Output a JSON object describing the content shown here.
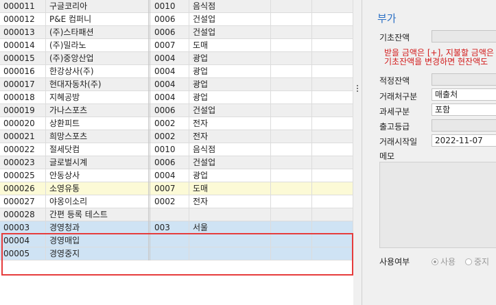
{
  "grid": {
    "rows": [
      {
        "code": "000011",
        "name": "구글코리아",
        "tcode": "0010",
        "tname": "음식점"
      },
      {
        "code": "000012",
        "name": "P&E 컴퍼니",
        "tcode": "0006",
        "tname": "건설업"
      },
      {
        "code": "000013",
        "name": "(주)스타패션",
        "tcode": "0006",
        "tname": "건설업"
      },
      {
        "code": "000014",
        "name": "(주)밀라노",
        "tcode": "0007",
        "tname": "도매"
      },
      {
        "code": "000015",
        "name": "(주)중앙산업",
        "tcode": "0004",
        "tname": "광업"
      },
      {
        "code": "000016",
        "name": "한강상사(주)",
        "tcode": "0004",
        "tname": "광업"
      },
      {
        "code": "000017",
        "name": "현대자동차(주)",
        "tcode": "0004",
        "tname": "광업"
      },
      {
        "code": "000018",
        "name": "지혜공방",
        "tcode": "0004",
        "tname": "광업"
      },
      {
        "code": "000019",
        "name": "가나스포츠",
        "tcode": "0006",
        "tname": "건설업"
      },
      {
        "code": "000020",
        "name": "상환피트",
        "tcode": "0002",
        "tname": "전자"
      },
      {
        "code": "000021",
        "name": "희망스포츠",
        "tcode": "0002",
        "tname": "전자"
      },
      {
        "code": "000022",
        "name": "절세닷컴",
        "tcode": "0010",
        "tname": "음식점"
      },
      {
        "code": "000023",
        "name": "글로벌시계",
        "tcode": "0006",
        "tname": "건설업"
      },
      {
        "code": "000025",
        "name": "안동상사",
        "tcode": "0004",
        "tname": "광업"
      },
      {
        "code": "000026",
        "name": "소영유통",
        "tcode": "0007",
        "tname": "도매"
      },
      {
        "code": "000027",
        "name": "야옹이소리",
        "tcode": "0002",
        "tname": "전자"
      },
      {
        "code": "000028",
        "name": "간편 등록 테스트",
        "tcode": "",
        "tname": ""
      },
      {
        "code": "00003",
        "name": "경영청과",
        "tcode": "003",
        "tname": "서울"
      },
      {
        "code": "00004",
        "name": "경영매입",
        "tcode": "",
        "tname": ""
      },
      {
        "code": "00005",
        "name": "경영중지",
        "tcode": "",
        "tname": ""
      }
    ]
  },
  "panel": {
    "title": "부가",
    "opening_balance_label": "기초잔액",
    "note_line1": "받을 금액은 [+], 지불할 금액은",
    "note_line2": "기초잔액을 변경하면 현잔액도",
    "proper_balance_label": "적정잔액",
    "trade_type_label": "거래처구분",
    "trade_type_value": "매출처",
    "tax_type_label": "과세구분",
    "tax_type_value": "포함",
    "shipping_grade_label": "출고등급",
    "start_date_label": "거래시작일",
    "start_date_value": "2022-11-07",
    "memo_label": "메모",
    "usage_label": "사용여부",
    "usage_on": "사용",
    "usage_off": "중지"
  },
  "colors": {
    "title_blue": "#2a6fc4",
    "note_red": "#d21a1a",
    "selection_border": "#e63b3b",
    "selected_row": "#cfe3f4",
    "highlight_row": "#fcfad6"
  }
}
